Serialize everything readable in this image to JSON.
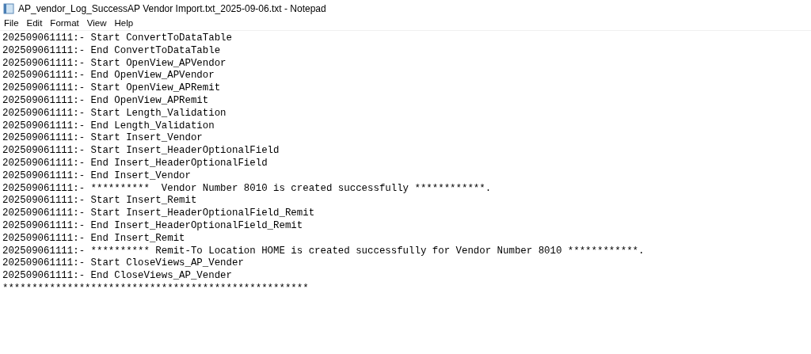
{
  "window": {
    "title": "AP_vendor_Log_SuccessAP Vendor Import.txt_2025-09-06.txt - Notepad"
  },
  "menu": [
    "File",
    "Edit",
    "Format",
    "View",
    "Help"
  ],
  "lines": [
    "202509061111:- Start ConvertToDataTable",
    "202509061111:- End ConvertToDataTable",
    "202509061111:- Start OpenView_APVendor",
    "202509061111:- End OpenView_APVendor",
    "202509061111:- Start OpenView_APRemit",
    "202509061111:- End OpenView_APRemit",
    "202509061111:- Start Length_Validation",
    "202509061111:- End Length_Validation",
    "202509061111:- Start Insert_Vendor",
    "202509061111:- Start Insert_HeaderOptionalField",
    "202509061111:- End Insert_HeaderOptionalField",
    "202509061111:- End Insert_Vendor",
    "202509061111:- **********  Vendor Number 8010 is created successfully ************.",
    "202509061111:- Start Insert_Remit",
    "202509061111:- Start Insert_HeaderOptionalField_Remit",
    "202509061111:- End Insert_HeaderOptionalField_Remit",
    "202509061111:- End Insert_Remit",
    "202509061111:- ********** Remit-To Location HOME is created successfully for Vendor Number 8010 ************.",
    "202509061111:- Start CloseViews_AP_Vender",
    "202509061111:- End CloseViews_AP_Vender",
    "****************************************************"
  ]
}
